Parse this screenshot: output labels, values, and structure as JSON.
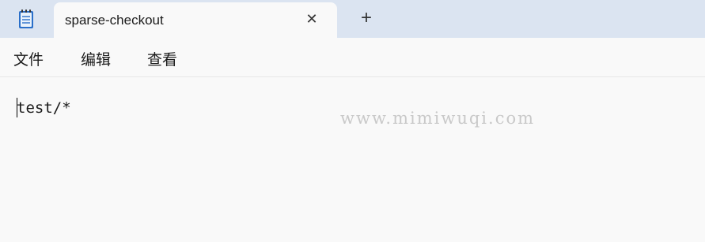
{
  "tab": {
    "title": "sparse-checkout",
    "close_symbol": "✕"
  },
  "new_tab_symbol": "+",
  "menu": {
    "file": "文件",
    "edit": "编辑",
    "view": "查看"
  },
  "editor": {
    "content": "test/*"
  },
  "watermark": "www.mimiwuqi.com",
  "icons": {
    "app": "notepad-icon",
    "close": "close-icon",
    "new_tab": "plus-icon"
  },
  "colors": {
    "titlebar": "#dbe4f1",
    "background": "#f9f9f9"
  }
}
